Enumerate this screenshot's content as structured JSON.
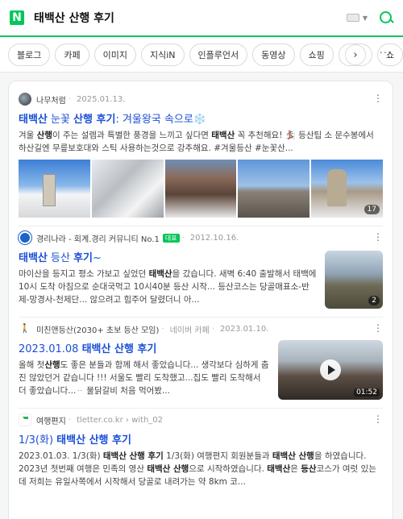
{
  "header": {
    "logo": "N",
    "query": "태백산 산행 후기"
  },
  "tabs": [
    "블로그",
    "카페",
    "이미지",
    "지식iN",
    "인플루언서",
    "동영상",
    "쇼핑",
    "뉴스",
    "쇼"
  ],
  "tabs_next_icon": "chevron-right-icon",
  "tabs_more": "···",
  "results": [
    {
      "source": "나무처럼",
      "date": "2025.01.13.",
      "title_parts": [
        "태백산",
        " 눈꽃 ",
        "산행 후기",
        ": 겨울왕국 속으로❄️"
      ],
      "desc_parts": [
        "겨울 ",
        "산행",
        "이 주는 설렘과 특별한 풍경을 느끼고 싶다면 ",
        "태백산",
        " 꼭 추천해요! 🏂 등산팁 소 문수봉에서 하산길엔 무릎보호대와 스틱 사용하는것으로 강추해요. #겨울등산 #눈꽃산..."
      ],
      "image_count": "17"
    },
    {
      "source": "경리나라 - 회계.경리 커뮤니티 No.1",
      "badge": "대표",
      "date": "2012.10.16.",
      "title_parts": [
        "태백산",
        " 등산 ",
        "후기",
        "~"
      ],
      "desc_parts": [
        "마이산을 등지고 평소 가보고 싶었던 ",
        "태백산",
        "을 갔습니다. 새벽 6:40 출발해서 태백에 10시 도착 아침으로 순대국먹고 10시40분 등산 시작... 등산코스는 당골매표소-반제-망경사-천제단... 않으려고 힘주어 달렸더니 아..."
      ],
      "image_count": "2"
    },
    {
      "source": "미친앤등산(2030+ 초보 등산 모임)",
      "cafe": "네이버 카페",
      "date": "2023.01.10.",
      "title_parts": [
        "2023.01.08 ",
        "태백산 산행 후기",
        "",
        ""
      ],
      "desc_parts": [
        "올해 첫",
        "산행",
        "도 좋은 분들과 함께 해서 좋았습니다... 생각보다 심하게 춥진 않았던거 같습니다 !!! 서울도 빨리 도착했고...집도 빨리 도착해서 더 좋았습니다...ᆢ 물닭갈비 처음 먹어봤..."
      ],
      "video_duration": "01:52"
    },
    {
      "source": "여행편지",
      "url": "tletter.co.kr › with_02",
      "title_parts": [
        "1/3(화) ",
        "태백산 산행 후기",
        "",
        ""
      ],
      "desc_parts": [
        "2023.01.03.  1/3(화) ",
        "태백산 산행 후기",
        " 1/3(화) 여행편지 회원분들과 ",
        "태백산 산행",
        "을 하였습니다. 2023년 첫번째 여행은 민족의 영산 ",
        "태백산 산행",
        "으로 시작하였습니다. ",
        "태백산",
        "은 ",
        "등산",
        "코스가 여럿 있는데 저희는 유일사쪽에서 시작해서 당골로 내려가는 약 8km 코..."
      ]
    }
  ],
  "colors": {
    "brand": "#03c75a",
    "link": "#1a4fd6"
  }
}
